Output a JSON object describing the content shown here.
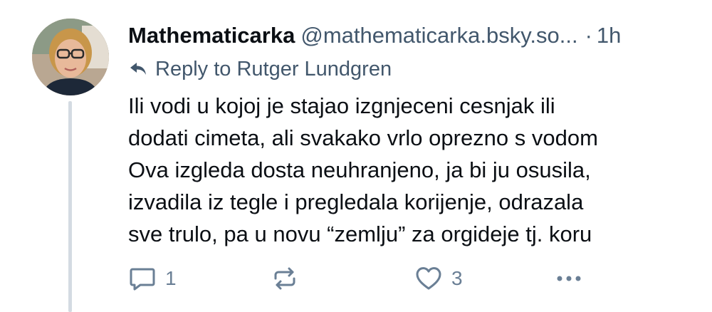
{
  "post": {
    "author_name": "Mathematicarka",
    "author_handle": "@mathematicarka.bsky.so...",
    "separator": "·",
    "time": "1h",
    "reply_to": "Reply to Rutger Lundgren",
    "body_lines": [
      "Ili vodi u kojoj je stajao izgnjeceni cesnjak ili",
      "dodati cimeta, ali svakako vrlo oprezno s vodom",
      "Ova izgleda dosta neuhranjeno, ja bi ju osusila,",
      "izvadila iz tegle i pregledala korijenje, odrazala",
      "sve trulo, pa u novu “zemlju” za orgideje tj. koru"
    ],
    "actions": {
      "reply_count": "1",
      "like_count": "3"
    }
  },
  "icons": {
    "reply_to": "reply-arrow-icon",
    "reply": "speech-bubble-icon",
    "repost": "repost-arrows-icon",
    "like": "heart-icon",
    "more": "ellipsis-icon"
  },
  "colors": {
    "text_primary": "#0b0f14",
    "text_secondary": "#42576c",
    "icon_muted": "#6a7f95",
    "thread_line": "#d4dbe2"
  }
}
